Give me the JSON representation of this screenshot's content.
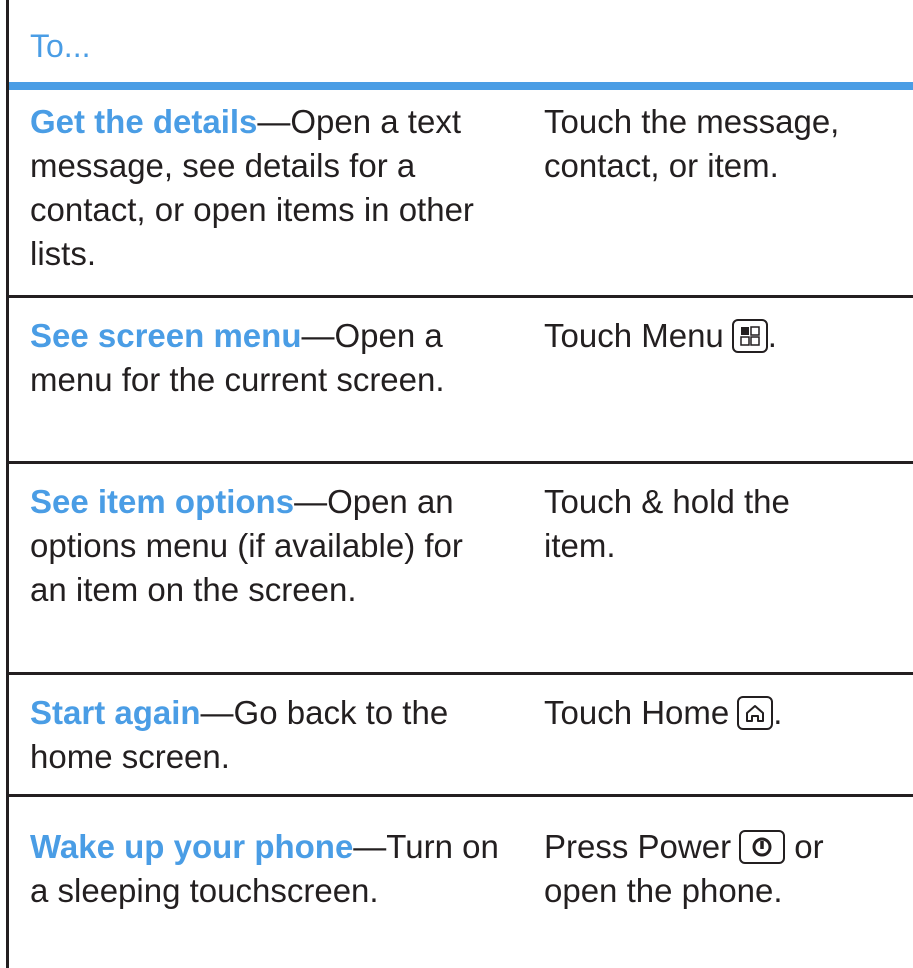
{
  "header": {
    "label": "To..."
  },
  "rows": [
    {
      "term": "Get the details",
      "description": "—Open a text message, see details for a contact, or open items in other lists.",
      "action_lines": [
        "Touch the message,",
        "contact, or item."
      ]
    },
    {
      "term": "See screen menu",
      "description": "—Open a menu for the current screen.",
      "action_prefix": "Touch Menu",
      "action_suffix": ".",
      "action_icon": "menu-key-icon"
    },
    {
      "term": "See item options",
      "description": "—Open an options menu (if available) for an item on the screen.",
      "action_lines": [
        "Touch & hold the",
        "item."
      ]
    },
    {
      "term": "Start again",
      "description": "—Go back to the home screen.",
      "action_prefix": "Touch Home",
      "action_suffix": ".",
      "action_icon": "home-key-icon"
    },
    {
      "term": "Wake up your phone",
      "description": "—Turn on a sleeping touchscreen.",
      "action_prefix": "Press Power",
      "action_suffix": " or",
      "action_line2": "open the phone.",
      "action_icon": "power-key-icon"
    }
  ],
  "colors": {
    "accent": "#4a9de5",
    "text": "#231f20",
    "rule": "#231f20"
  }
}
